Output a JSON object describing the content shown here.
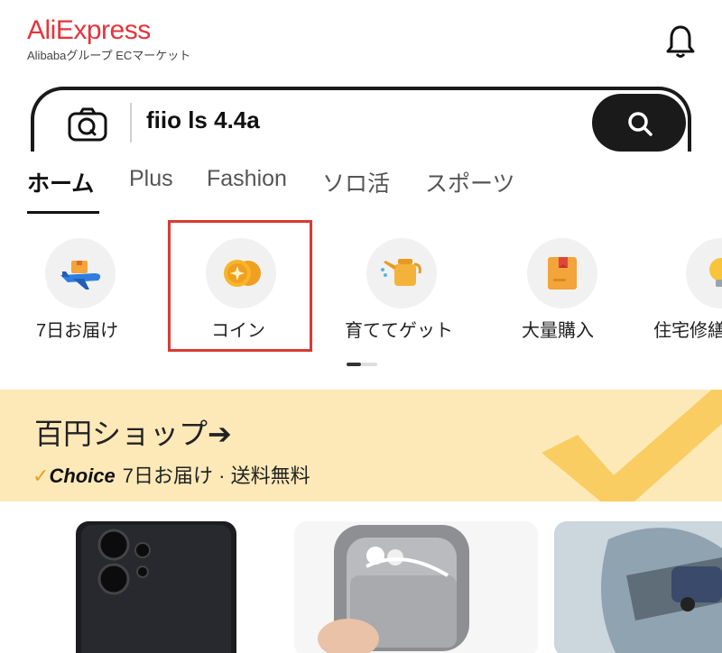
{
  "header": {
    "logo_text": "AliExpress",
    "logo_subtitle": "Alibabaグループ ECマーケット",
    "notification_icon": "bell-icon"
  },
  "search": {
    "query": "fiio ls 4.4a",
    "camera_icon": "camera-icon",
    "search_icon": "search-icon"
  },
  "tabs": [
    {
      "label": "ホーム",
      "active": true
    },
    {
      "label": "Plus",
      "active": false
    },
    {
      "label": "Fashion",
      "active": false
    },
    {
      "label": "ソロ活",
      "active": false
    },
    {
      "label": "スポーツ",
      "active": false
    }
  ],
  "categories": [
    {
      "label": "7日お届け",
      "icon": "delivery-plane-icon"
    },
    {
      "label": "コイン",
      "icon": "coin-icon"
    },
    {
      "label": "育ててゲット",
      "icon": "watering-can-icon"
    },
    {
      "label": "大量購入",
      "icon": "package-box-icon"
    },
    {
      "label": "住宅修繕",
      "icon": "lightbulb-icon"
    }
  ],
  "banner": {
    "title": "百円ショップ➔",
    "choice_label": "Choice",
    "info": "7日お届け · 送料無料"
  },
  "colors": {
    "brand": "#e8333a",
    "banner_bg": "#fde9b8",
    "highlight": "#d93a34",
    "accent_orange": "#f0a020"
  }
}
